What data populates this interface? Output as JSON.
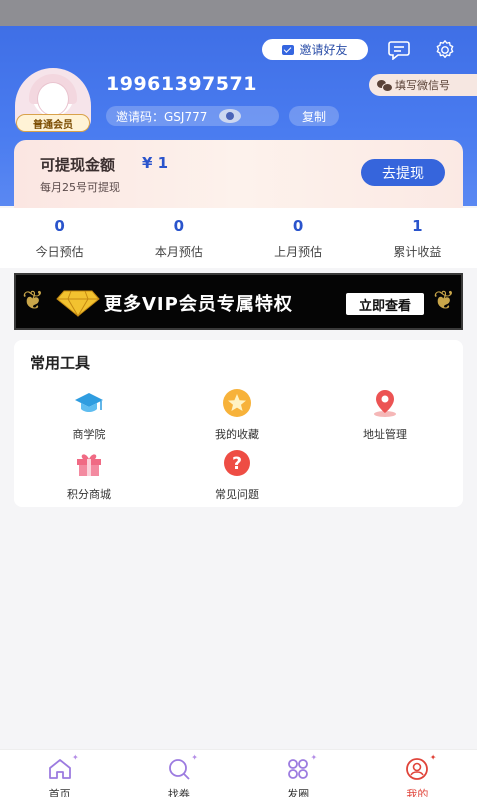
{
  "header": {
    "invite_label": "邀请好友",
    "phone": "19961397571",
    "level_badge": "普通会员",
    "wechat_label": "填写微信号",
    "invite_code_label": "邀请码：GSJ777",
    "copy_label": "复制",
    "accent_color": "#3f6fe6"
  },
  "balance": {
    "label": "可提现金额",
    "amount": "¥ 1",
    "note": "每月25号可提现",
    "withdraw_label": "去提现"
  },
  "stats": [
    {
      "value": "0",
      "label": "今日预估"
    },
    {
      "value": "0",
      "label": "本月预估"
    },
    {
      "value": "0",
      "label": "上月预估"
    },
    {
      "value": "1",
      "label": "累计收益"
    }
  ],
  "vip": {
    "title": "更多VIP会员专属特权",
    "button": "立即查看"
  },
  "tools": {
    "title": "常用工具",
    "items": [
      {
        "label": "商学院",
        "icon": "graduation-cap-icon"
      },
      {
        "label": "我的收藏",
        "icon": "star-icon"
      },
      {
        "label": "地址管理",
        "icon": "location-pin-icon"
      },
      {
        "label": "积分商城",
        "icon": "gift-icon"
      },
      {
        "label": "常见问题",
        "icon": "question-icon"
      }
    ]
  },
  "tabbar": [
    {
      "label": "首页",
      "icon": "home-icon"
    },
    {
      "label": "找券",
      "icon": "search-coupon-icon"
    },
    {
      "label": "发圈",
      "icon": "share-circle-icon"
    },
    {
      "label": "我的",
      "icon": "profile-icon",
      "active": true
    }
  ]
}
